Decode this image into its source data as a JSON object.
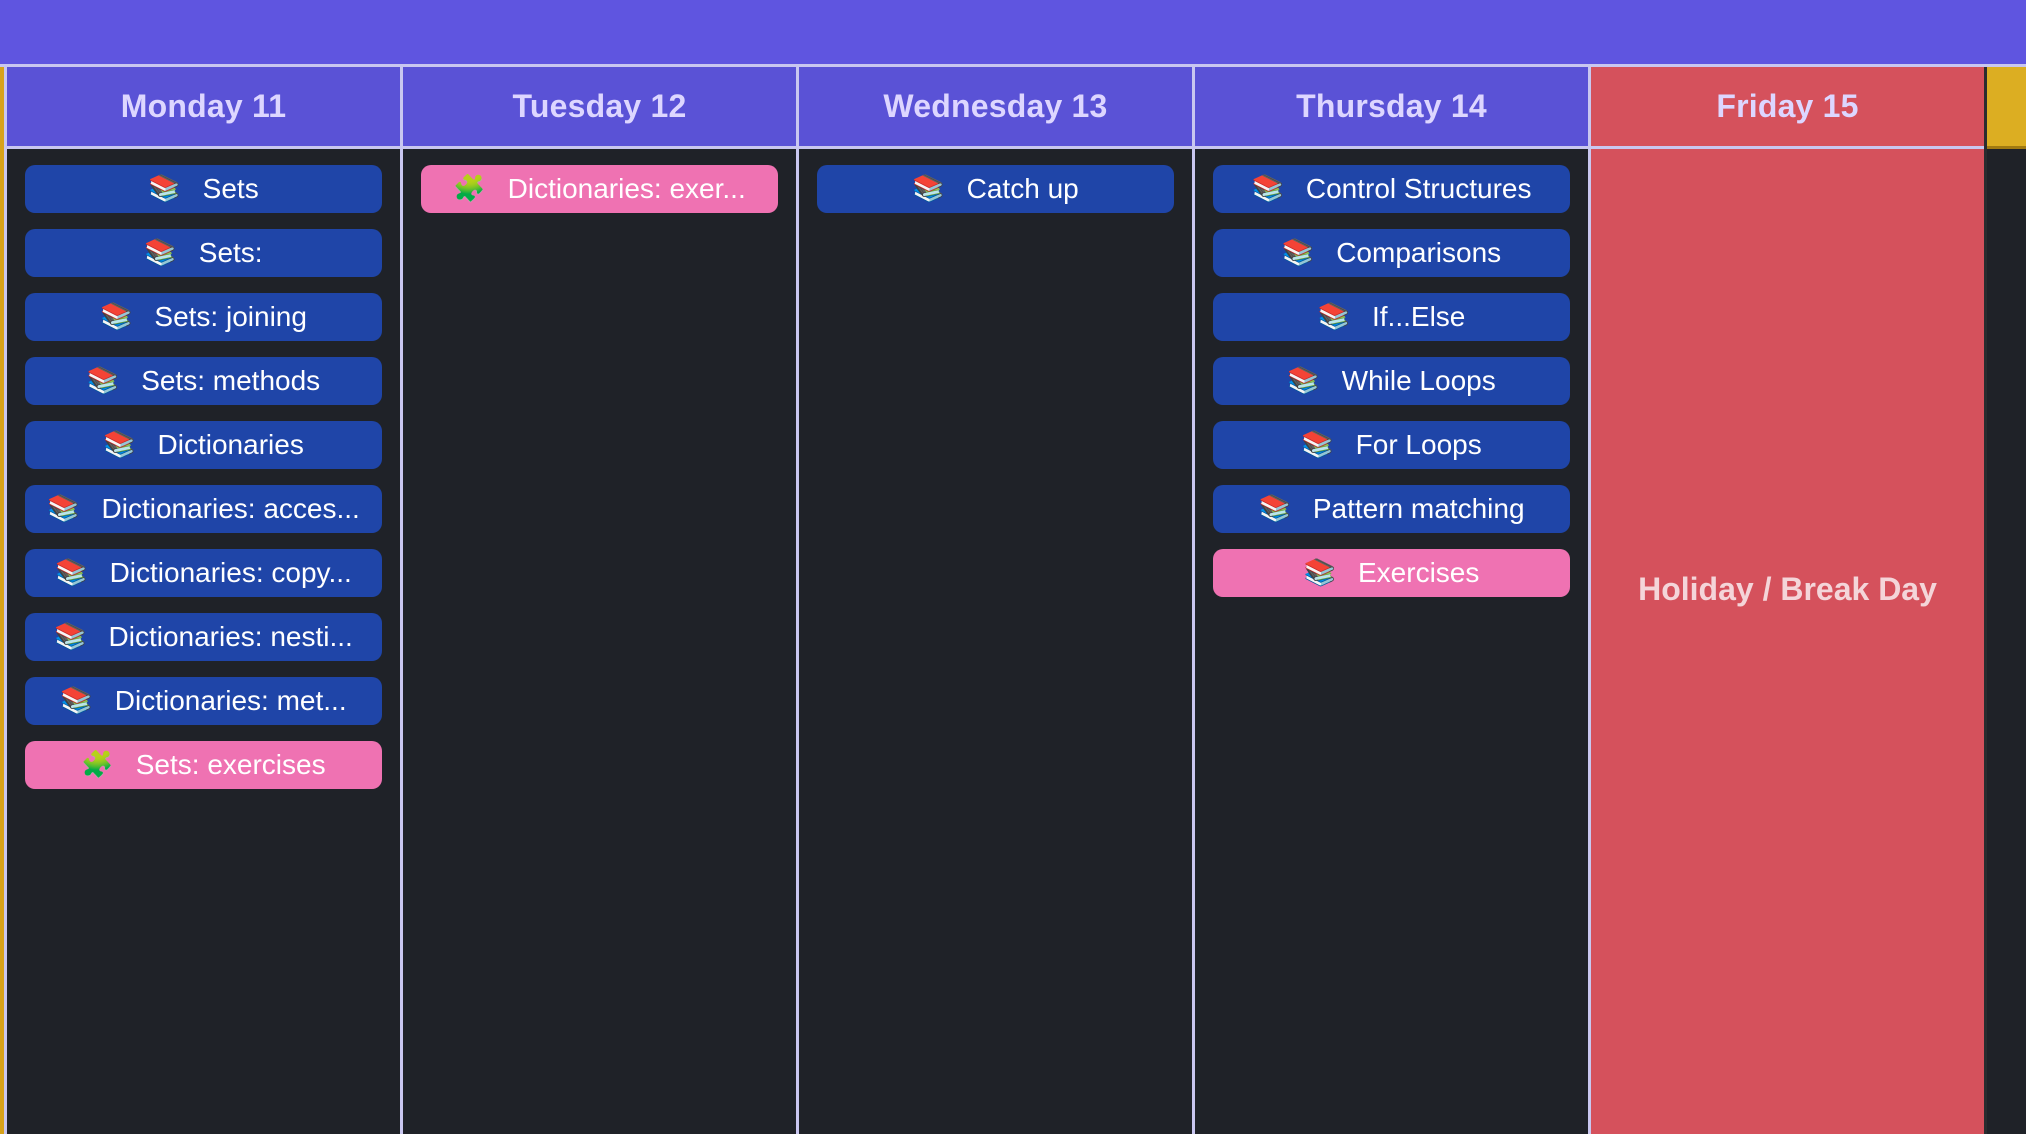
{
  "week": {
    "days": [
      {
        "title": "Monday 11",
        "events": [
          {
            "label": "Sets",
            "type": "lesson",
            "icon": "📚",
            "icon_name": "books-icon"
          },
          {
            "label": "Sets:",
            "type": "lesson",
            "icon": "📚",
            "icon_name": "books-icon"
          },
          {
            "label": "Sets: joining",
            "type": "lesson",
            "icon": "📚",
            "icon_name": "books-icon"
          },
          {
            "label": "Sets: methods",
            "type": "lesson",
            "icon": "📚",
            "icon_name": "books-icon"
          },
          {
            "label": "Dictionaries",
            "type": "lesson",
            "icon": "📚",
            "icon_name": "books-icon"
          },
          {
            "label": "Dictionaries: acces...",
            "type": "lesson",
            "icon": "📚",
            "icon_name": "books-icon"
          },
          {
            "label": "Dictionaries: copy...",
            "type": "lesson",
            "icon": "📚",
            "icon_name": "books-icon"
          },
          {
            "label": "Dictionaries: nesti...",
            "type": "lesson",
            "icon": "📚",
            "icon_name": "books-icon"
          },
          {
            "label": "Dictionaries: met...",
            "type": "lesson",
            "icon": "📚",
            "icon_name": "books-icon"
          },
          {
            "label": "Sets: exercises",
            "type": "exercise",
            "icon": "🧩",
            "icon_name": "puzzle-icon"
          }
        ]
      },
      {
        "title": "Tuesday 12",
        "events": [
          {
            "label": "Dictionaries: exer...",
            "type": "exercise",
            "icon": "🧩",
            "icon_name": "puzzle-icon"
          }
        ]
      },
      {
        "title": "Wednesday 13",
        "events": [
          {
            "label": "Catch up",
            "type": "lesson",
            "icon": "📚",
            "icon_name": "books-icon"
          }
        ]
      },
      {
        "title": "Thursday 14",
        "events": [
          {
            "label": "Control Structures",
            "type": "lesson",
            "icon": "📚",
            "icon_name": "books-icon"
          },
          {
            "label": "Comparisons",
            "type": "lesson",
            "icon": "📚",
            "icon_name": "books-icon"
          },
          {
            "label": "If...Else",
            "type": "lesson",
            "icon": "📚",
            "icon_name": "books-icon"
          },
          {
            "label": "While Loops",
            "type": "lesson",
            "icon": "📚",
            "icon_name": "books-icon"
          },
          {
            "label": "For Loops",
            "type": "lesson",
            "icon": "📚",
            "icon_name": "books-icon"
          },
          {
            "label": "Pattern matching",
            "type": "lesson",
            "icon": "📚",
            "icon_name": "books-icon"
          },
          {
            "label": "Exercises",
            "type": "exercise",
            "icon": "📚",
            "icon_name": "books-icon"
          }
        ]
      },
      {
        "title": "Friday 15",
        "holiday": true,
        "holiday_label": "Holiday / Break Day"
      }
    ]
  },
  "colors": {
    "topbar": "#5f55e0",
    "day_header": "#5a52d6",
    "lesson": "#1f45a8",
    "exercise": "#ef72b2",
    "holiday": "#d5515c",
    "accent_edge": "#dcae22"
  }
}
